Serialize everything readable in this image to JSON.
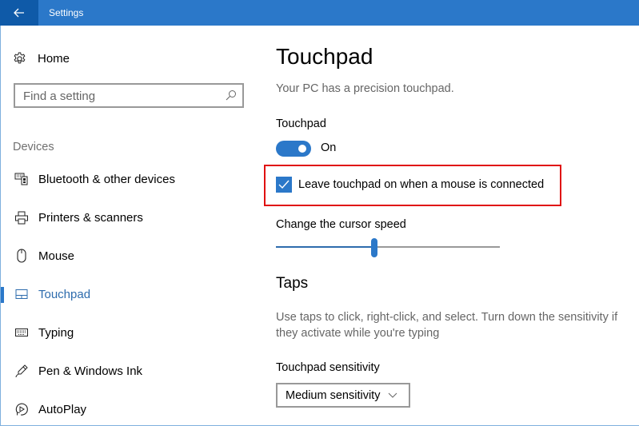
{
  "window": {
    "title": "Settings",
    "accent_color": "#2b78c9",
    "back_button_color": "#0f5aa8"
  },
  "sidebar": {
    "home": {
      "label": "Home",
      "icon": "gear-icon"
    },
    "search": {
      "placeholder": "Find a setting",
      "value": "",
      "icon": "search-icon"
    },
    "section_label": "Devices",
    "items": [
      {
        "label": "Bluetooth & other devices",
        "icon": "bluetooth-devices-icon",
        "active": false
      },
      {
        "label": "Printers & scanners",
        "icon": "printer-icon",
        "active": false
      },
      {
        "label": "Mouse",
        "icon": "mouse-icon",
        "active": false
      },
      {
        "label": "Touchpad",
        "icon": "touchpad-icon",
        "active": true
      },
      {
        "label": "Typing",
        "icon": "keyboard-icon",
        "active": false
      },
      {
        "label": "Pen & Windows Ink",
        "icon": "pen-icon",
        "active": false
      },
      {
        "label": "AutoPlay",
        "icon": "autoplay-icon",
        "active": false
      }
    ]
  },
  "main": {
    "title": "Touchpad",
    "description": "Your PC has a precision touchpad.",
    "touchpad_toggle": {
      "label": "Touchpad",
      "state_label": "On",
      "on": true
    },
    "leave_on_checkbox": {
      "label": "Leave touchpad on when a mouse is connected",
      "checked": true,
      "highlight_color": "#e01010"
    },
    "cursor_speed": {
      "label": "Change the cursor speed",
      "value_fraction": 0.44
    },
    "taps": {
      "title": "Taps",
      "description": "Use taps to click, right-click, and select. Turn down the sensitivity if they activate while you're typing",
      "sensitivity": {
        "label": "Touchpad sensitivity",
        "selected": "Medium sensitivity"
      }
    }
  }
}
